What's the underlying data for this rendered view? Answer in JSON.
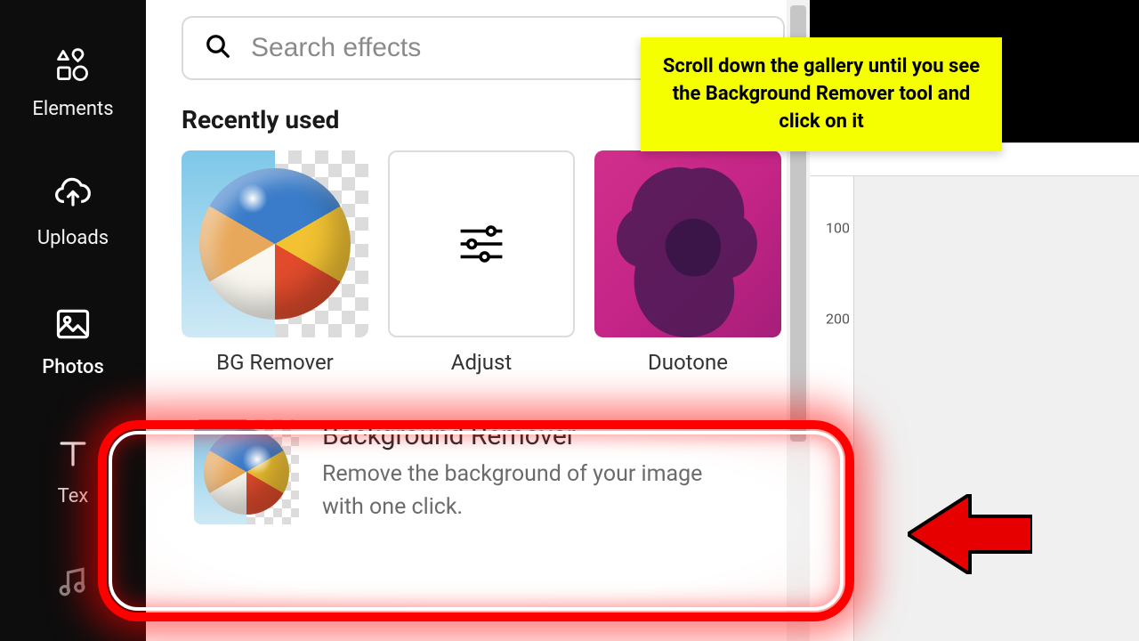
{
  "nav": {
    "items": [
      {
        "label": "Elements",
        "icon": "elements-icon"
      },
      {
        "label": "Uploads",
        "icon": "upload-icon"
      },
      {
        "label": "Photos",
        "icon": "photo-icon",
        "active": true
      },
      {
        "label": "Tex",
        "icon": "text-icon"
      }
    ]
  },
  "panel": {
    "search_placeholder": "Search effects",
    "recent_heading": "Recently used",
    "recent": [
      {
        "label": "BG Remover",
        "kind": "bgremover"
      },
      {
        "label": "Adjust",
        "kind": "adjust"
      },
      {
        "label": "Duotone",
        "kind": "duotone"
      }
    ],
    "tool_row": {
      "title": "Background Remover",
      "description": "Remove the background of your image with one click."
    }
  },
  "ruler": {
    "ticks": [
      "100",
      "200"
    ]
  },
  "annotation": {
    "callout": "Scroll down the gallery until you see the Background Remover tool and click on it"
  }
}
